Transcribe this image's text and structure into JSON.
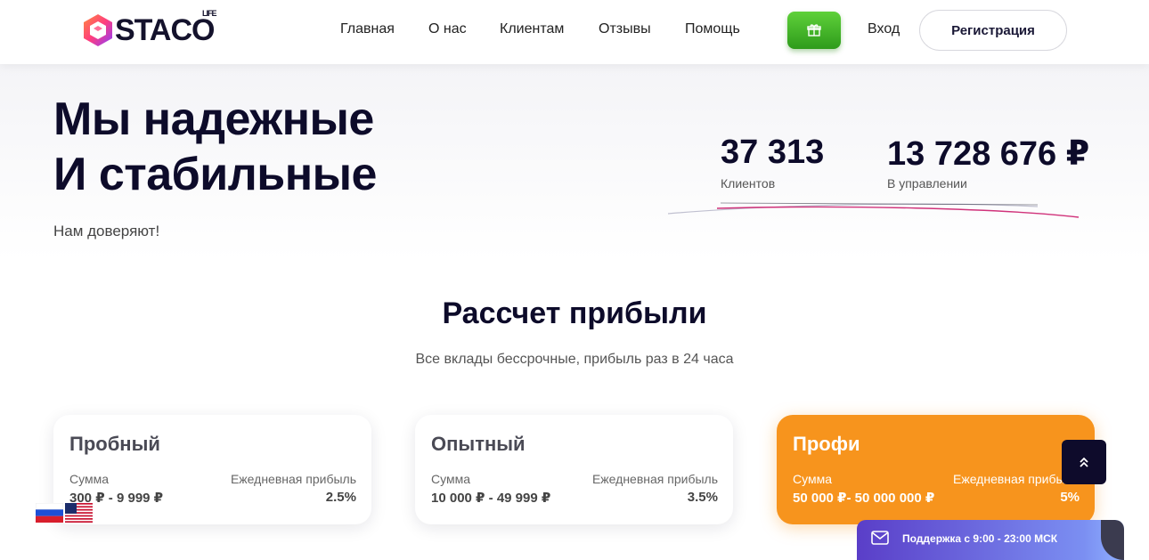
{
  "header": {
    "logo_text": "STACO",
    "logo_suffix": "LIFE",
    "nav": [
      "Главная",
      "О нас",
      "Клиентам",
      "Отзывы",
      "Помощь"
    ],
    "login_label": "Вход",
    "register_label": "Регистрация",
    "gift_icon": "gift-icon"
  },
  "hero": {
    "title_line1": "Мы надежные",
    "title_line2": "И стабильные",
    "subtitle": "Нам доверяют!",
    "stats": [
      {
        "value": "37 313",
        "label": "Клиентов"
      },
      {
        "value": "13 728 676 ₽",
        "label": "В управлении"
      }
    ]
  },
  "calc": {
    "title": "Рассчет прибыли",
    "subtitle": "Все вклады бессрочные, прибыль раз в 24 часа",
    "sum_label": "Сумма",
    "profit_label": "Ежедневная прибыль",
    "plans": [
      {
        "name": "Пробный",
        "range": "300 ₽ - 9 999 ₽",
        "rate": "2.5%"
      },
      {
        "name": "Опытный",
        "range": "10 000 ₽ - 49 999 ₽",
        "rate": "3.5%"
      },
      {
        "name": "Профи",
        "range": "50 000 ₽- 50 000 000 ₽",
        "rate": "5%",
        "profit_label_visible": "Ежедневная прибы"
      }
    ]
  },
  "languages": [
    "ru-flag-icon",
    "us-flag-icon"
  ],
  "support": {
    "text": "Поддержка с 9:00 - 23:00 МСК",
    "icon": "mail-icon"
  },
  "scroll_top_icon": "double-chevron-up-icon",
  "colors": {
    "accent_orange": "#f7941d",
    "dark": "#0e0b2b",
    "gift_green": "#3fb52a",
    "support_purple": "#5a3ec8"
  }
}
